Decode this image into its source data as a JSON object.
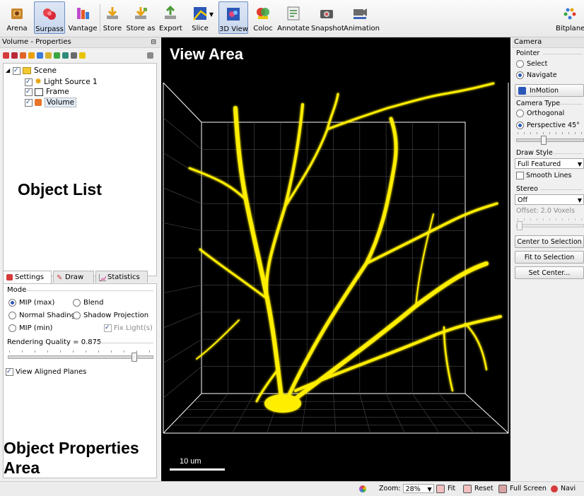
{
  "toolbar": {
    "buttons": [
      {
        "label": "Arena",
        "icon": "arena-icon"
      },
      {
        "label": "Surpass",
        "icon": "surpass-icon",
        "active": true
      },
      {
        "label": "Vantage",
        "icon": "vantage-icon"
      },
      {
        "label": "Store",
        "icon": "store-icon"
      },
      {
        "label": "Store as",
        "icon": "store-as-icon"
      },
      {
        "label": "Export",
        "icon": "export-icon"
      },
      {
        "label": "Slice",
        "icon": "slice-icon"
      },
      {
        "label": "3D View",
        "icon": "3d-view-icon",
        "active": true
      },
      {
        "label": "Coloc",
        "icon": "coloc-icon"
      },
      {
        "label": "Annotate",
        "icon": "annotate-icon"
      },
      {
        "label": "Snapshot",
        "icon": "snapshot-icon"
      },
      {
        "label": "Animation",
        "icon": "animation-icon"
      },
      {
        "label": "Bitplane",
        "icon": "bitplane-logo-icon"
      }
    ]
  },
  "left_panel": {
    "header": "Volume - Properties",
    "tree": [
      {
        "label": "Scene",
        "icon": "folder-icon",
        "checked": true
      },
      {
        "label": "Light Source 1",
        "icon": "light-source-icon",
        "checked": true
      },
      {
        "label": "Frame",
        "icon": "frame-icon",
        "checked": true
      },
      {
        "label": "Volume",
        "icon": "volume-icon",
        "checked": true,
        "selected": true
      }
    ],
    "object_list_label": "Object List",
    "tabs": [
      {
        "label": "Settings",
        "icon": "settings-icon",
        "active": true
      },
      {
        "label": "Draw",
        "icon": "draw-icon"
      },
      {
        "label": "Statistics",
        "icon": "statistics-icon"
      }
    ],
    "mode": {
      "title": "Mode",
      "options": {
        "mip_max": "MIP (max)",
        "blend": "Blend",
        "normal_shading": "Normal Shading",
        "shadow_projection": "Shadow Projection",
        "mip_min": "MIP (min)",
        "fix_lights": "Fix Light(s)"
      },
      "selected": "MIP (max)"
    },
    "rendering_quality": {
      "label": "Rendering Quality = 0.875",
      "value": 0.875
    },
    "view_aligned_planes": {
      "label": "View Aligned Planes",
      "checked": true
    },
    "properties_label": "Object Properties Area"
  },
  "view": {
    "title": "View Area",
    "scale_label": "10 um",
    "colors": {
      "background": "#000000",
      "signal": "#ffee00",
      "frame": "#ffffff",
      "grid": "#5a5a5a"
    }
  },
  "right_panel": {
    "header": "Camera",
    "pointer": {
      "title": "Pointer",
      "options": [
        "Select",
        "Navigate"
      ],
      "selected": "Navigate"
    },
    "inmotion": "InMotion",
    "camera_type": {
      "title": "Camera Type",
      "options": [
        "Orthogonal",
        "Perspective 45°"
      ],
      "selected": "Perspective 45°"
    },
    "draw_style": {
      "title": "Draw Style",
      "value": "Full Featured",
      "smooth_lines": "Smooth Lines"
    },
    "stereo": {
      "title": "Stereo",
      "value": "Off",
      "offset": "Offset: 2.0 Voxels"
    },
    "buttons": {
      "center": "Center to Selection",
      "fit": "Fit to Selection",
      "set_center": "Set Center..."
    }
  },
  "statusbar": {
    "zoom_label": "Zoom:",
    "zoom_value": "28%",
    "fit": "Fit",
    "reset": "Reset",
    "full_screen": "Full Screen",
    "navi": "Navi"
  }
}
